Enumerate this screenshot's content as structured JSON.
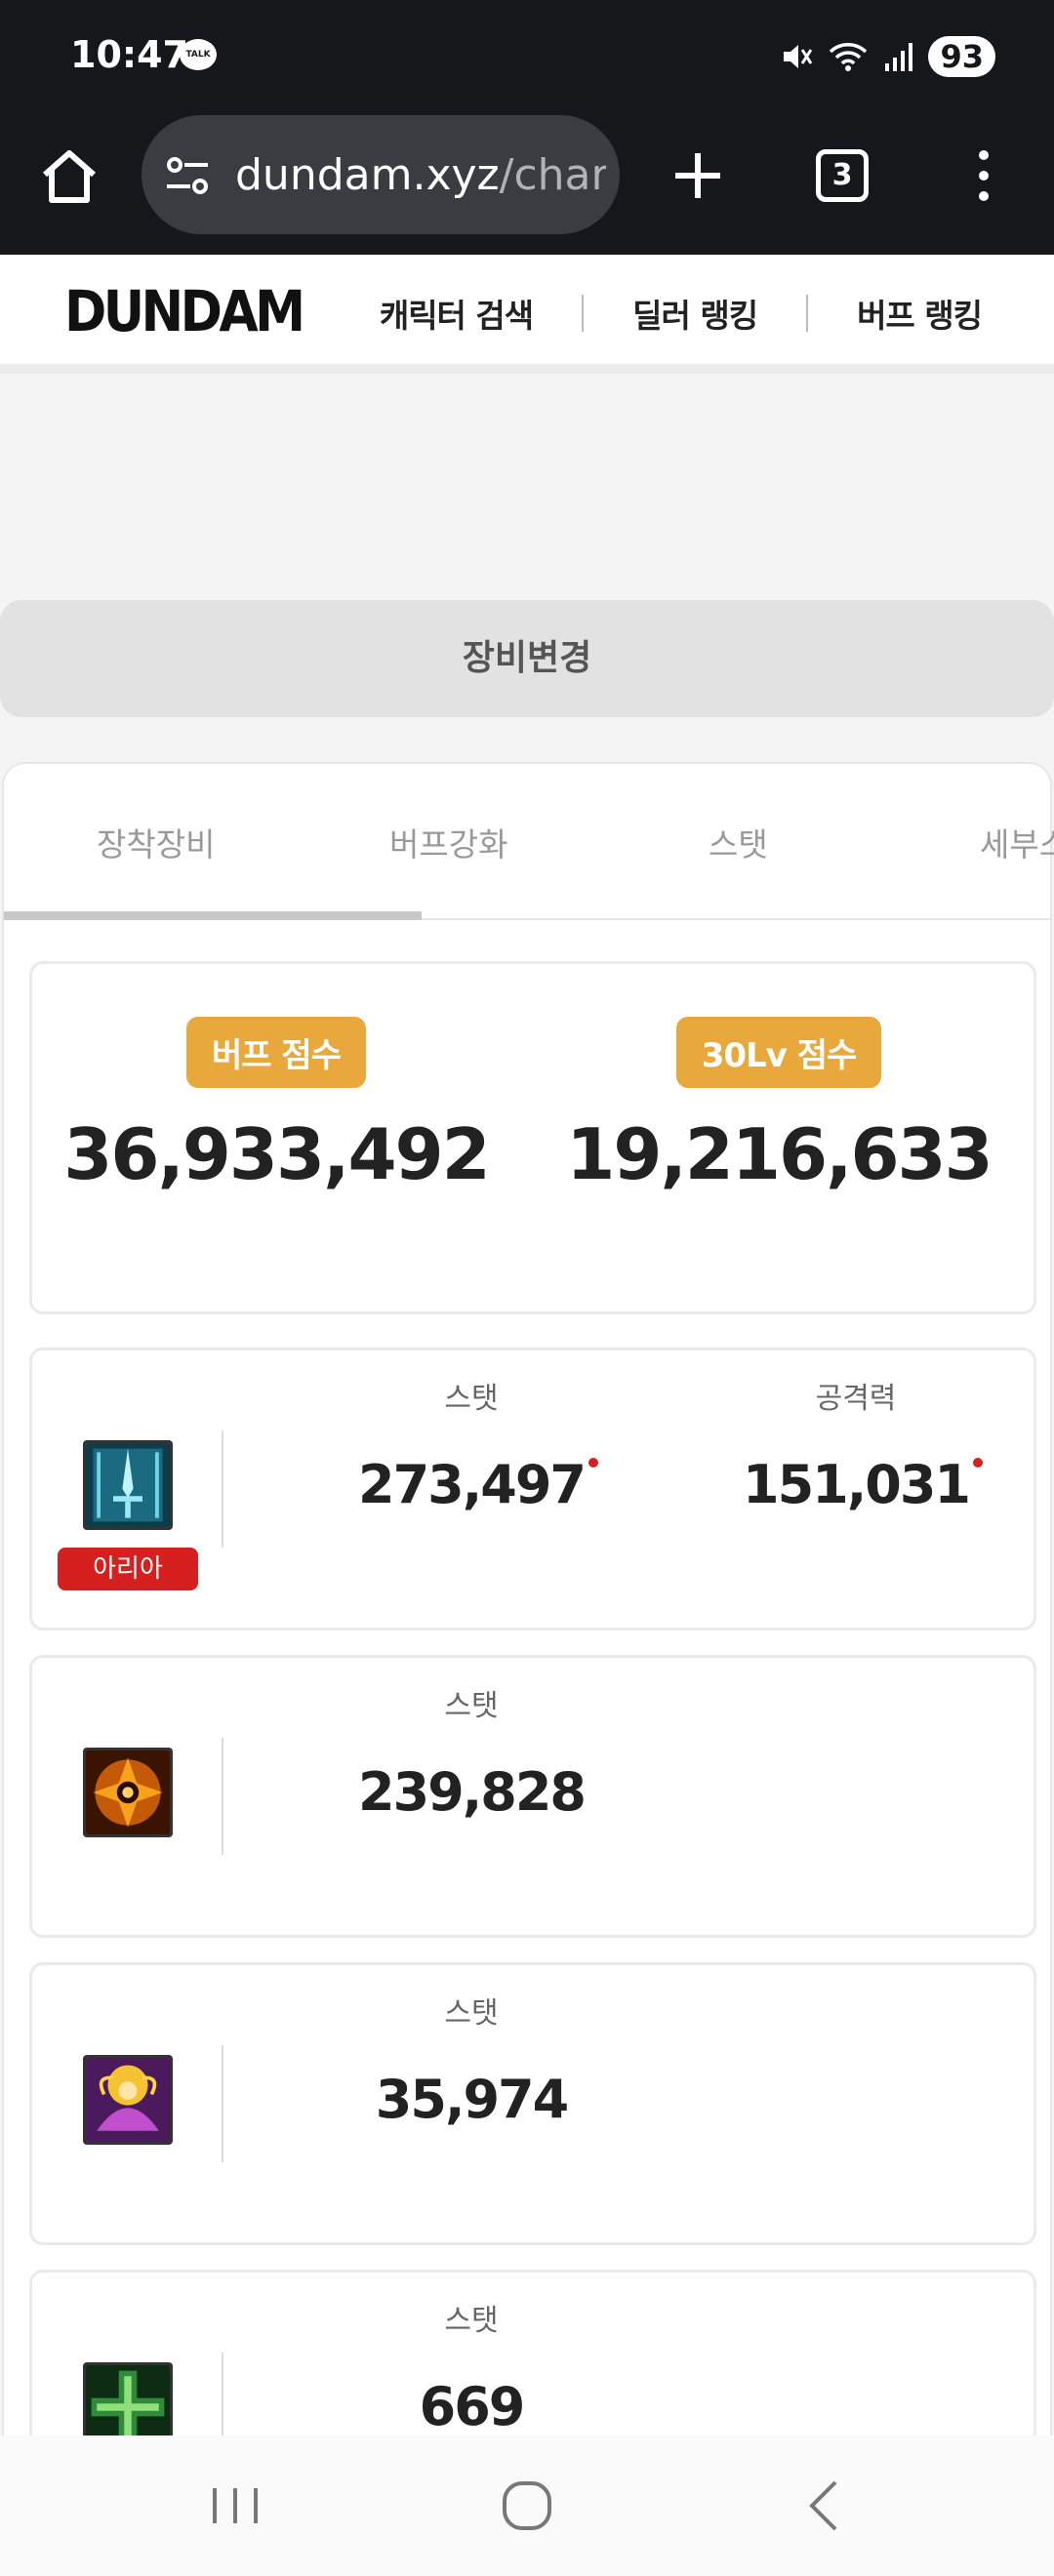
{
  "status": {
    "time": "10:47",
    "talk_icon": "TALK",
    "battery": "93"
  },
  "browser": {
    "url_domain": "dundam.xyz",
    "url_path": "/char",
    "tab_count": "3"
  },
  "header": {
    "logo": "DUNDAM",
    "nav": [
      "캐릭터 검색",
      "딜러 랭킹",
      "버프 랭킹"
    ]
  },
  "equip_change_label": "장비변경",
  "tabs": [
    "장착장비",
    "버프강화",
    "스탯",
    "세부스"
  ],
  "scores": [
    {
      "label": "버프 점수",
      "value": "36,933,492"
    },
    {
      "label": "30Lv 점수",
      "value": "19,216,633"
    }
  ],
  "buffs": [
    {
      "icon": "sword-buff-icon",
      "tag": "아리아",
      "stats": [
        {
          "label": "스탯",
          "value": "273,497"
        },
        {
          "label": "공격력",
          "value": "151,031"
        }
      ]
    },
    {
      "icon": "flame-emblem-icon",
      "stats": [
        {
          "label": "스탯",
          "value": "239,828"
        }
      ]
    },
    {
      "icon": "angel-buff-icon",
      "stats": [
        {
          "label": "스탯",
          "value": "35,974"
        }
      ]
    },
    {
      "icon": "green-cross-icon",
      "stats": [
        {
          "label": "스탯",
          "value": "669"
        }
      ]
    }
  ],
  "colors": {
    "accent": "#e9a83b",
    "tag_red": "#d61f1f",
    "dark_bar": "#16171b"
  }
}
